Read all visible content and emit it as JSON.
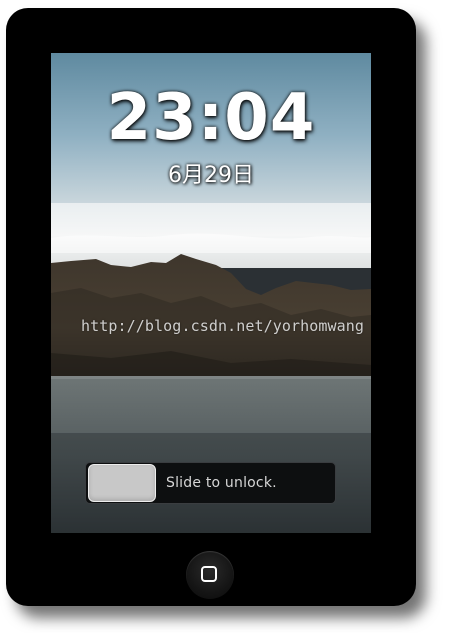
{
  "lockscreen": {
    "time": "23:04",
    "date": "6月29日"
  },
  "unlock": {
    "label": "Slide to unlock."
  },
  "watermark": {
    "text": "http://blog.csdn.net/yorhomwang"
  },
  "colors": {
    "device_body": "#000000",
    "sky_top": "#6c96ac",
    "mountain": "#3a3228",
    "water": "#5d6668",
    "handle": "#c8c8c8"
  },
  "icons": {
    "home": "home-button-icon"
  }
}
